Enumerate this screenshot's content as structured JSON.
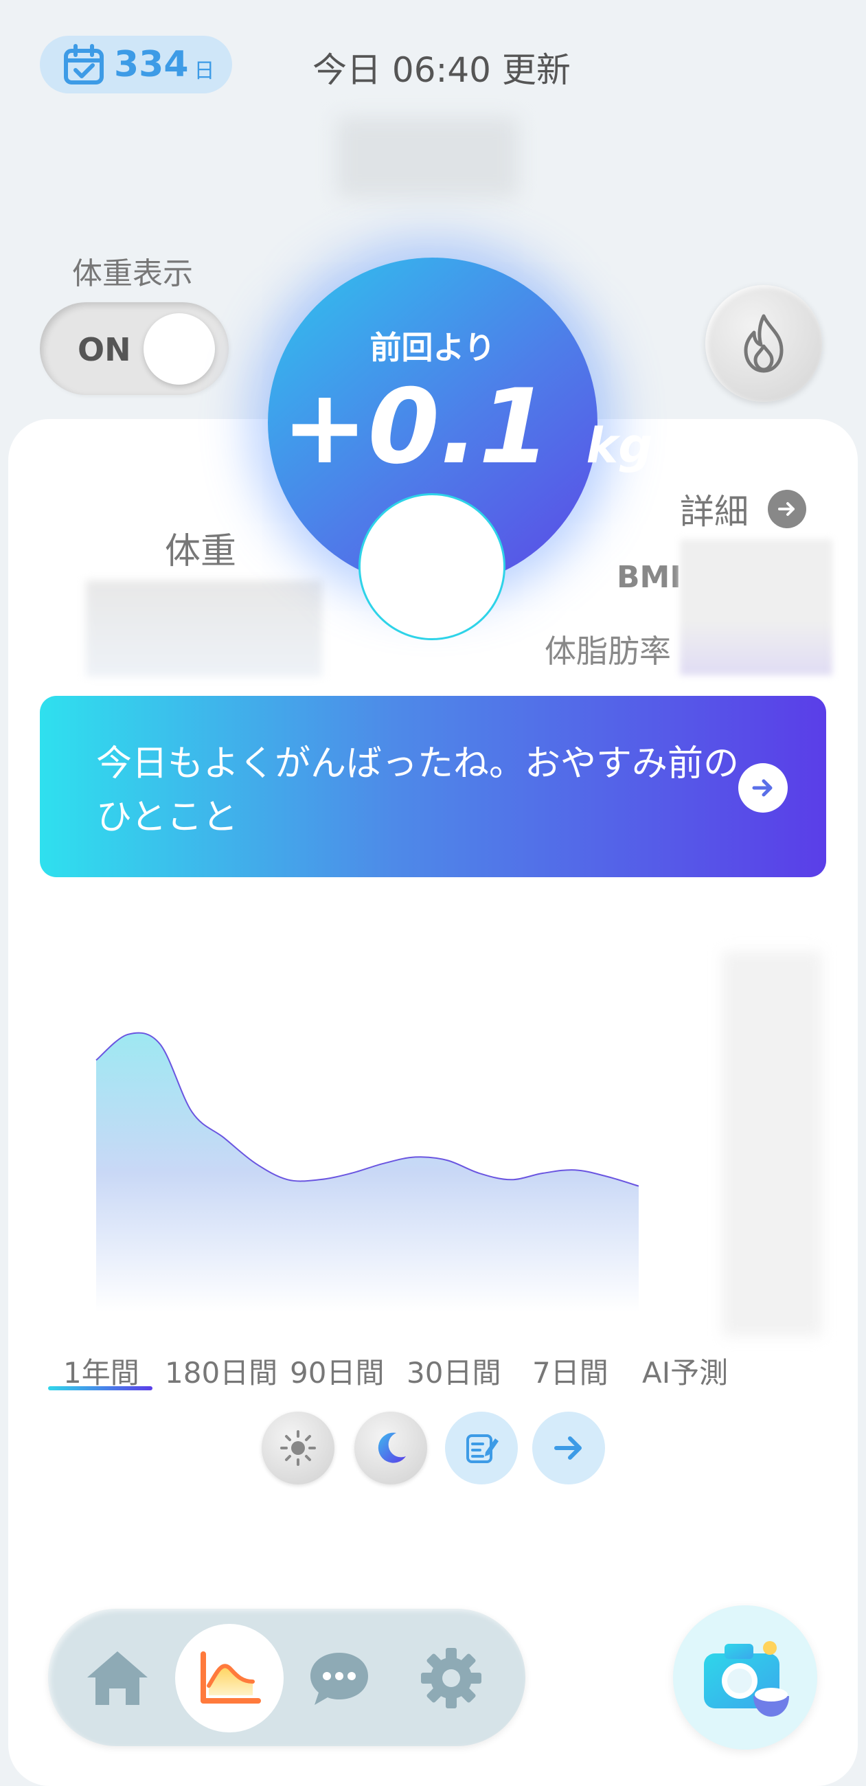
{
  "header": {
    "days_count": "334",
    "days_unit": "日",
    "updated_text": "今日 06:40 更新"
  },
  "weight_display": {
    "label": "体重表示",
    "toggle_state": "ON"
  },
  "summary": {
    "change_label": "前回より",
    "change_value": "+0.1",
    "change_unit": "kg",
    "weight_label": "体重",
    "detail_label": "詳細",
    "bmi_label": "BMI",
    "body_fat_label": "体脂肪率"
  },
  "message": {
    "text": "今日もよくがんばったね。おやすみ前のひとこと"
  },
  "chart_data": {
    "type": "area",
    "title": "",
    "xlabel": "",
    "ylabel": "",
    "series": [
      {
        "values": [
          0.78,
          0.86,
          0.83,
          0.62,
          0.54,
          0.46,
          0.41,
          0.41,
          0.43,
          0.46,
          0.48,
          0.47,
          0.43,
          0.41,
          0.43,
          0.44,
          0.42,
          0.39
        ]
      }
    ],
    "ylim": [
      0,
      1
    ],
    "colors": {
      "line": "#6a55e0",
      "fill_top": "#9ee8f2",
      "fill_bottom": "#ffffff"
    }
  },
  "range_tabs": [
    {
      "label": "1年間",
      "active": true
    },
    {
      "label": "180日間",
      "active": false
    },
    {
      "label": "90日間",
      "active": false
    },
    {
      "label": "30日間",
      "active": false
    },
    {
      "label": "7日間",
      "active": false
    },
    {
      "label": "AI予測",
      "active": false
    }
  ],
  "chart_controls": [
    "sun-icon",
    "moon-icon",
    "memo-icon",
    "arrow-right-icon"
  ],
  "bottom_nav": {
    "items": [
      "home-icon",
      "graph-icon",
      "chat-icon",
      "settings-icon"
    ],
    "active": "graph-icon"
  },
  "colors": {
    "accent_blue": "#3d9be6",
    "gradient_start": "#2fe0ee",
    "gradient_end": "#5a3ee8"
  }
}
